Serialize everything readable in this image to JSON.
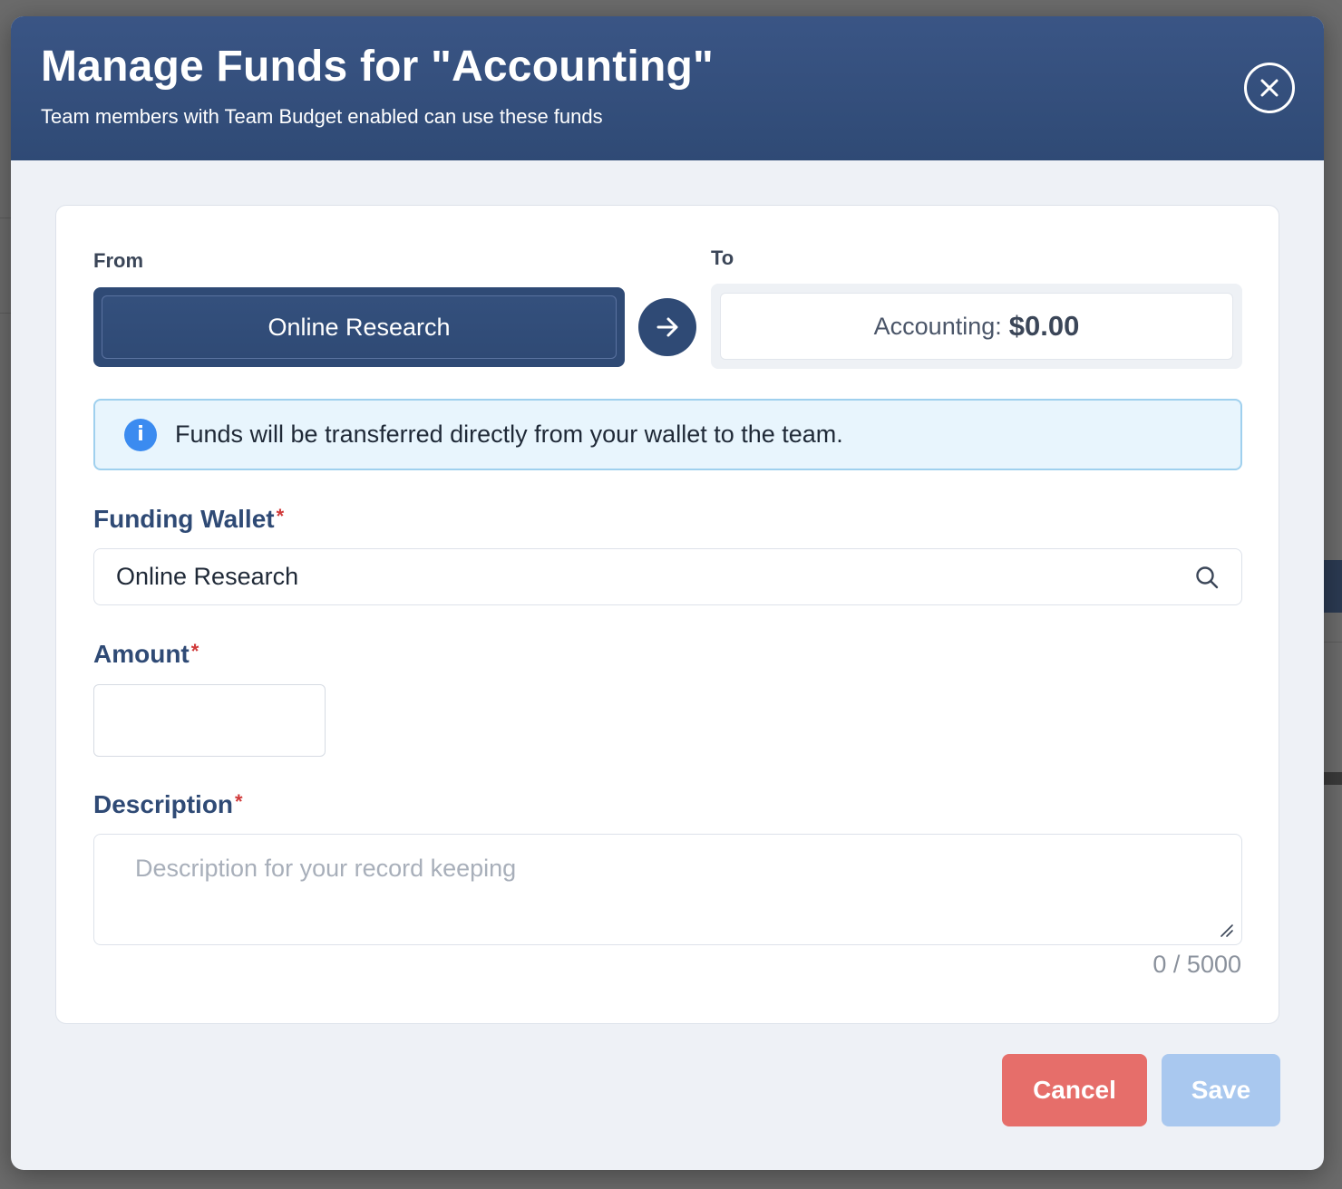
{
  "modal": {
    "title": "Manage Funds for \"Accounting\"",
    "subtitle": "Team members with Team Budget enabled can use these funds"
  },
  "transfer": {
    "from_label": "From",
    "from_value": "Online Research",
    "to_label": "To",
    "to_name": "Accounting:",
    "to_amount": "$0.00"
  },
  "info": {
    "text": "Funds will be transferred directly from your wallet to the team."
  },
  "form": {
    "funding_wallet_label": "Funding Wallet",
    "funding_wallet_value": "Online Research",
    "amount_label": "Amount",
    "amount_value": "",
    "description_label": "Description",
    "description_placeholder": "Description for your record keeping",
    "description_value": "",
    "char_count": "0 / 5000",
    "required_marker": "*"
  },
  "actions": {
    "cancel_label": "Cancel",
    "save_label": "Save"
  },
  "colors": {
    "header_bg": "#2f4a75",
    "cancel_bg": "#e66e6a",
    "save_bg": "#a9c8ef",
    "info_bg": "#e8f5fd",
    "info_icon": "#3b8bf0"
  }
}
